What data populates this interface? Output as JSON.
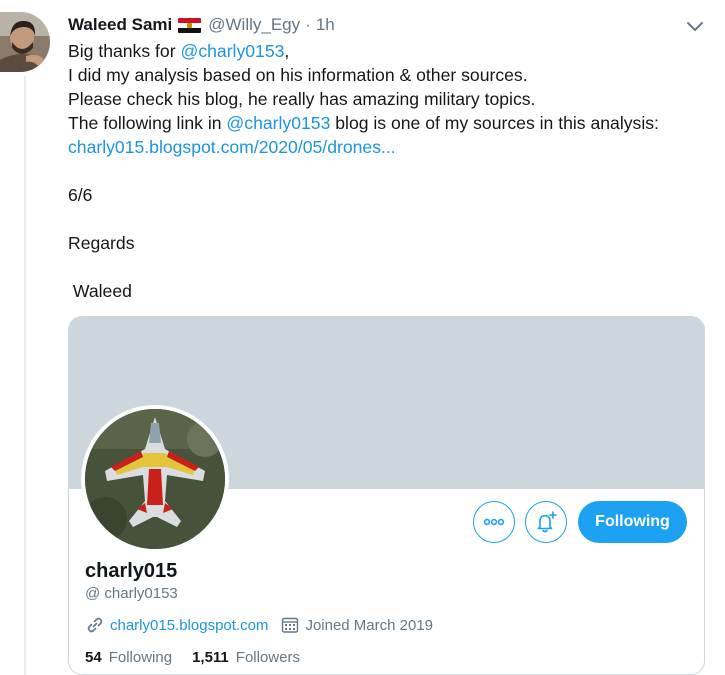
{
  "tweet": {
    "author_name": "Waleed Sami",
    "author_flag": "egypt-flag",
    "author_handle": "@Willy_Egy",
    "separator": "·",
    "time": "1h",
    "lines": [
      {
        "pre": "Big thanks for ",
        "mention": "@charly0153",
        "post": ","
      },
      {
        "text": "I did my analysis based on his information & other sources."
      },
      {
        "text": "Please check his blog, he really has amazing military topics."
      },
      {
        "pre": "The following link in ",
        "mention": "@charly0153",
        "post": " blog is one of my sources in this analysis:"
      },
      {
        "link": "charly015.blogspot.com/2020/05/drones..."
      }
    ],
    "counter": "6/6",
    "closing": "Regards",
    "signature": " Waleed"
  },
  "profile_card": {
    "name": "charly015",
    "handle": "@ charly0153",
    "website": "charly015.blogspot.com",
    "joined": "Joined March 2019",
    "following_count": "54",
    "following_label": "Following",
    "followers_count": "1,511",
    "followers_label": "Followers",
    "follow_button_label": "Following",
    "more_icon": "more-icon",
    "bell_icon": "notification-bell-icon"
  },
  "colors": {
    "link": "#1b95e0",
    "accent": "#1da1f2",
    "muted": "#657786",
    "banner": "#ccd6dd",
    "text": "#14171a"
  }
}
